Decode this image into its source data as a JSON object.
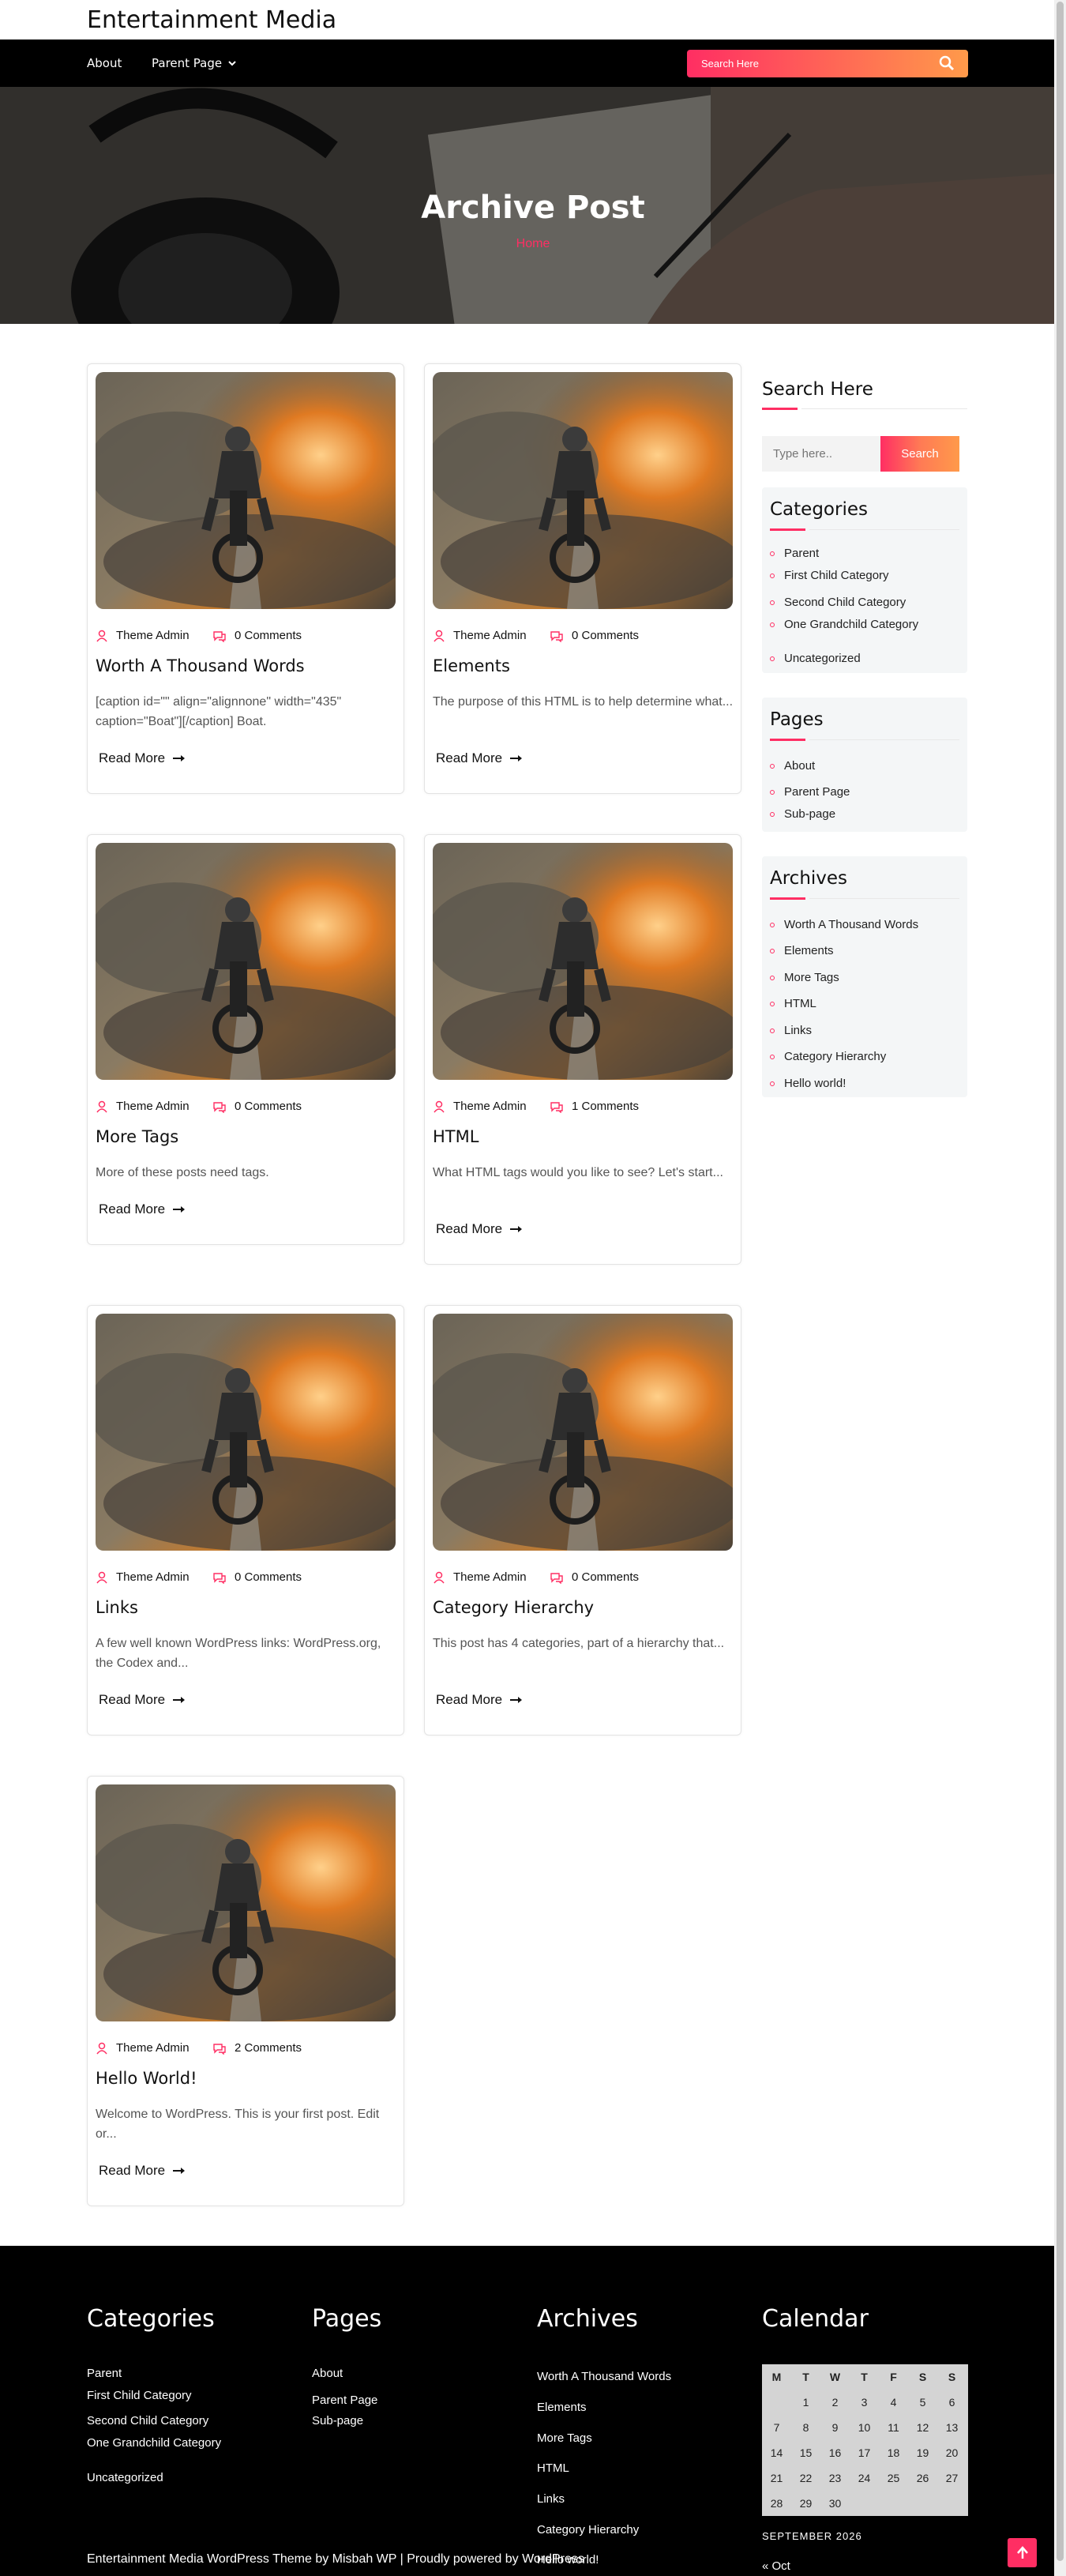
{
  "site": {
    "title": "Entertainment Media"
  },
  "nav": {
    "items": [
      {
        "label": "About"
      },
      {
        "label": "Parent Page"
      }
    ],
    "search_placeholder": "Search Here"
  },
  "hero": {
    "title": "Archive Post",
    "breadcrumb": "Home"
  },
  "posts": [
    {
      "author": "Theme Admin",
      "comments": "0 Comments",
      "title": "Worth A Thousand Words",
      "excerpt": "[caption id=\"\" align=\"alignnone\" width=\"435\" caption=\"Boat\"][/caption] Boat.",
      "read_more": "Read More"
    },
    {
      "author": "Theme Admin",
      "comments": "0 Comments",
      "title": "Elements",
      "excerpt": "The purpose of this HTML is to help determine what...",
      "read_more": "Read More"
    },
    {
      "author": "Theme Admin",
      "comments": "0 Comments",
      "title": "More Tags",
      "excerpt": "More of these posts need tags.",
      "read_more": "Read More"
    },
    {
      "author": "Theme Admin",
      "comments": "1 Comments",
      "title": "HTML",
      "excerpt": "What HTML tags would you like to see? Let's start...",
      "read_more": "Read More"
    },
    {
      "author": "Theme Admin",
      "comments": "0 Comments",
      "title": "Links",
      "excerpt": "A few well known WordPress links: WordPress.org, the Codex and...",
      "read_more": "Read More"
    },
    {
      "author": "Theme Admin",
      "comments": "0 Comments",
      "title": "Category Hierarchy",
      "excerpt": "This post has 4 categories, part of a hierarchy that...",
      "read_more": "Read More"
    },
    {
      "author": "Theme Admin",
      "comments": "2 Comments",
      "title": "Hello World!",
      "excerpt": "Welcome to WordPress. This is your first post. Edit or...",
      "read_more": "Read More"
    }
  ],
  "sidebar": {
    "search": {
      "title": "Search Here",
      "placeholder": "Type here..",
      "button": "Search"
    },
    "categories": {
      "title": "Categories",
      "items": [
        "Parent",
        "First Child Category",
        "Second Child Category",
        "One Grandchild Category",
        "Uncategorized"
      ]
    },
    "pages": {
      "title": "Pages",
      "items": [
        "About",
        "Parent Page",
        "Sub-page"
      ]
    },
    "archives": {
      "title": "Archives",
      "items": [
        "Worth A Thousand Words",
        "Elements",
        "More Tags",
        "HTML",
        "Links",
        "Category Hierarchy",
        "Hello world!"
      ]
    }
  },
  "footer": {
    "categories": {
      "title": "Categories",
      "items": [
        "Parent",
        "First Child Category",
        "Second Child Category",
        "One Grandchild Category",
        "Uncategorized"
      ]
    },
    "pages": {
      "title": "Pages",
      "items": [
        "About",
        "Parent Page",
        "Sub-page"
      ]
    },
    "archives": {
      "title": "Archives",
      "items": [
        "Worth A Thousand Words",
        "Elements",
        "More Tags",
        "HTML",
        "Links",
        "Category Hierarchy",
        "Hello world!"
      ]
    },
    "calendar": {
      "title": "Calendar",
      "weekdays": [
        "M",
        "T",
        "W",
        "T",
        "F",
        "S",
        "S"
      ],
      "weeks": [
        [
          "",
          "1",
          "2",
          "3",
          "4",
          "5",
          "6"
        ],
        [
          "7",
          "8",
          "9",
          "10",
          "11",
          "12",
          "13"
        ],
        [
          "14",
          "15",
          "16",
          "17",
          "18",
          "19",
          "20"
        ],
        [
          "21",
          "22",
          "23",
          "24",
          "25",
          "26",
          "27"
        ],
        [
          "28",
          "29",
          "30",
          "",
          "",
          "",
          ""
        ]
      ],
      "caption": "SEPTEMBER 2026",
      "prev": "« Oct"
    },
    "copyright": "Entertainment Media WordPress Theme by Misbah WP | Proudly powered by WordPress"
  },
  "colors": {
    "accent": "#ff2e63",
    "gradient_end": "#ff9a4a",
    "nav_bg": "#000000",
    "footer_bg": "#000000"
  }
}
